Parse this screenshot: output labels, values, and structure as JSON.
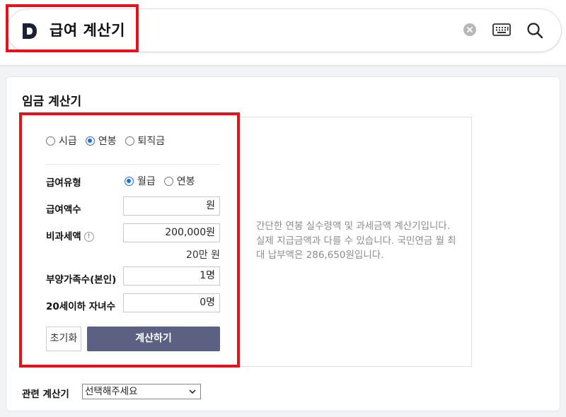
{
  "search": {
    "logo_letter": "D",
    "query": "급여 계산기",
    "icons": {
      "clear": "clear-circle-icon",
      "keyboard": "keyboard-icon",
      "search": "search-icon"
    }
  },
  "calculator": {
    "title": "임금 계산기",
    "modes": [
      {
        "label": "시급",
        "checked": false
      },
      {
        "label": "연봉",
        "checked": true
      },
      {
        "label": "퇴직금",
        "checked": false
      }
    ],
    "pay_type": {
      "label": "급여유형",
      "options": [
        {
          "label": "월급",
          "checked": true
        },
        {
          "label": "연봉",
          "checked": false
        }
      ]
    },
    "pay_amount": {
      "label": "급여액수",
      "value": "원"
    },
    "non_taxable": {
      "label": "비과세액",
      "info_icon": "!",
      "value": "200,000원",
      "hint": "20만 원"
    },
    "dependents": {
      "label": "부양가족수(본인)",
      "value": "1명"
    },
    "children": {
      "label": "20세이하 자녀수",
      "value": "0명"
    },
    "reset_label": "초기화",
    "submit_label": "계산하기",
    "result_text": "간단한 연봉 실수령액 및 과세금액 계산기입니다. 실제 지급금액과 다를 수 있습니다. 국민연금 월 최대 납부액은 286,650원입니다."
  },
  "related": {
    "label": "관련 계산기",
    "selected": "선택해주세요"
  },
  "colors": {
    "highlight": "#e8101a",
    "accent": "#1e6fd9",
    "submit_button": "#5c6183"
  }
}
